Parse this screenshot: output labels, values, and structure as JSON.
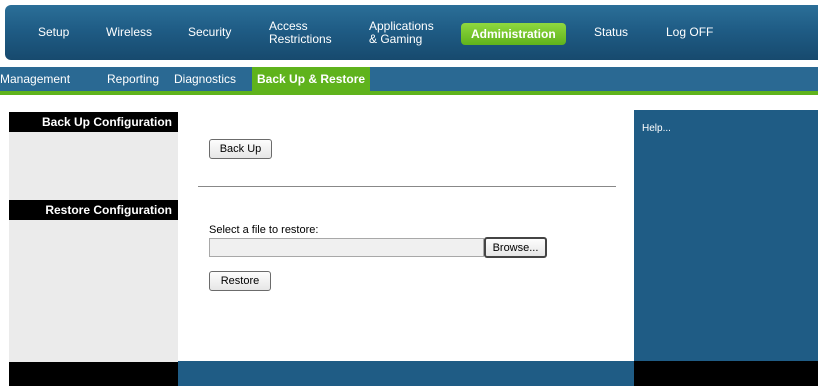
{
  "topnav": {
    "items": [
      {
        "label": "Setup"
      },
      {
        "label": "Wireless"
      },
      {
        "label": "Security"
      },
      {
        "label": "Access\nRestrictions"
      },
      {
        "label": "Applications\n& Gaming"
      },
      {
        "label": "Administration"
      },
      {
        "label": "Status"
      },
      {
        "label": "Log OFF"
      }
    ],
    "active": "Administration"
  },
  "subtabs": {
    "items": [
      {
        "label": "Management"
      },
      {
        "label": "Reporting"
      },
      {
        "label": "Diagnostics"
      },
      {
        "label": "Back Up & Restore"
      }
    ],
    "active": "Back Up & Restore"
  },
  "sections": {
    "backup": {
      "title": "Back Up Configuration",
      "button_label": "Back Up"
    },
    "restore": {
      "title": "Restore Configuration",
      "file_label": "Select a file to restore:",
      "file_value": "",
      "browse_label": "Browse...",
      "button_label": "Restore"
    }
  },
  "help": {
    "text": "Help..."
  },
  "colors": {
    "nav_blue": "#1f5c85",
    "accent_green": "#5fb31c",
    "section_black": "#000000"
  }
}
